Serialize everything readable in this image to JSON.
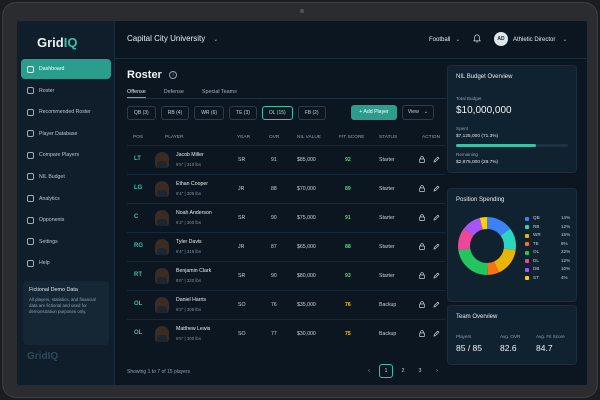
{
  "brand": {
    "logo_main": "Grid",
    "logo_accent": "IQ"
  },
  "sidebar": {
    "items": [
      {
        "label": "Dashboard",
        "active": true
      },
      {
        "label": "Roster"
      },
      {
        "label": "Recommended Roster"
      },
      {
        "label": "Player Database"
      },
      {
        "label": "Compare Players"
      },
      {
        "label": "NIL Budget"
      },
      {
        "label": "Analytics"
      },
      {
        "label": "Opponents"
      },
      {
        "label": "Settings"
      },
      {
        "label": "Help"
      }
    ],
    "demo": {
      "title": "Fictional Demo Data",
      "text": "All players, statistics, and financial data are fictional and used for demonstration purposes only."
    }
  },
  "header": {
    "university": "Capital City University",
    "sport": "Football",
    "user_initials": "AD",
    "user_role": "Athletic Director"
  },
  "page": {
    "title": "Roster",
    "tabs": [
      "Offense",
      "Defense",
      "Special Teams"
    ],
    "chips": [
      "QB (3)",
      "RB (4)",
      "WR (6)",
      "TE (3)",
      "OL (15)",
      "FB (2)"
    ],
    "add_player": "+ Add Player",
    "view": "View"
  },
  "table": {
    "headers": {
      "pos": "POS",
      "player": "PLAYER",
      "year": "YEAR",
      "ovr": "OVR",
      "nil": "NIL VALUE",
      "fit": "FIT SCORE",
      "status": "STATUS",
      "action": "ACTION"
    },
    "rows": [
      {
        "pos": "LT",
        "name": "Jacob Miller",
        "meta": "6'5\" | 310 lbs",
        "year": "SR",
        "ovr": "91",
        "nil": "$85,000",
        "fit": "92",
        "status": "Starter"
      },
      {
        "pos": "LG",
        "name": "Ethan Cooper",
        "meta": "6'4\" | 305 lbs",
        "year": "JR",
        "ovr": "88",
        "nil": "$70,000",
        "fit": "89",
        "status": "Starter"
      },
      {
        "pos": "C",
        "name": "Noah Anderson",
        "meta": "6'3\" | 300 lbs",
        "year": "SR",
        "ovr": "90",
        "nil": "$75,000",
        "fit": "91",
        "status": "Starter"
      },
      {
        "pos": "RG",
        "name": "Tyler Davis",
        "meta": "6'4\" | 315 lbs",
        "year": "JR",
        "ovr": "87",
        "nil": "$65,000",
        "fit": "88",
        "status": "Starter"
      },
      {
        "pos": "RT",
        "name": "Benjamin Clark",
        "meta": "6'6\" | 320 lbs",
        "year": "SR",
        "ovr": "90",
        "nil": "$80,000",
        "fit": "93",
        "status": "Starter"
      },
      {
        "pos": "OL",
        "name": "Daniel Harris",
        "meta": "6'3\" | 305 lbs",
        "year": "SO",
        "ovr": "76",
        "nil": "$35,000",
        "fit": "76",
        "status": "Backup"
      },
      {
        "pos": "OL",
        "name": "Matthew Lewis",
        "meta": "6'5\" | 300 lbs",
        "year": "SO",
        "ovr": "77",
        "nil": "$30,000",
        "fit": "75",
        "status": "Backup"
      }
    ],
    "footer": "Showing 1 to 7 of 15 players",
    "pages": [
      "1",
      "2",
      "3"
    ]
  },
  "nil_budget": {
    "title": "NIL Budget Overview",
    "total_label": "Total Budget",
    "total": "$10,000,000",
    "spent_label": "Spent",
    "spent": "$7,125,000 (71.3%)",
    "spent_fraction": 0.713,
    "remaining_label": "Remaining",
    "remaining": "$2,875,000 (28.7%)"
  },
  "position_spending": {
    "title": "Position Spending",
    "items": [
      {
        "label": "QB",
        "pct": "14%",
        "value": 14,
        "color": "#3b82f6"
      },
      {
        "label": "RB",
        "pct": "12%",
        "value": 12,
        "color": "#2dd4bf"
      },
      {
        "label": "WR",
        "pct": "15%",
        "value": 15,
        "color": "#eab308"
      },
      {
        "label": "TE",
        "pct": "6%",
        "value": 6,
        "color": "#f97316"
      },
      {
        "label": "OL",
        "pct": "22%",
        "value": 22,
        "color": "#22c55e"
      },
      {
        "label": "DL",
        "pct": "12%",
        "value": 12,
        "color": "#ec4899"
      },
      {
        "label": "DB",
        "pct": "10%",
        "value": 10,
        "color": "#a855f7"
      },
      {
        "label": "ST",
        "pct": "4%",
        "value": 4,
        "color": "#facc15"
      }
    ]
  },
  "team_overview": {
    "title": "Team Overview",
    "players_label": "Players",
    "players": "85 / 85",
    "ovr_label": "Avg. OVR",
    "ovr": "82.6",
    "fit_label": "Avg. Fit Score",
    "fit": "84.7"
  },
  "colors": {
    "accent": "#2a9d8f",
    "fit_high": "#4ade80",
    "fit_mid": "#facc15"
  }
}
